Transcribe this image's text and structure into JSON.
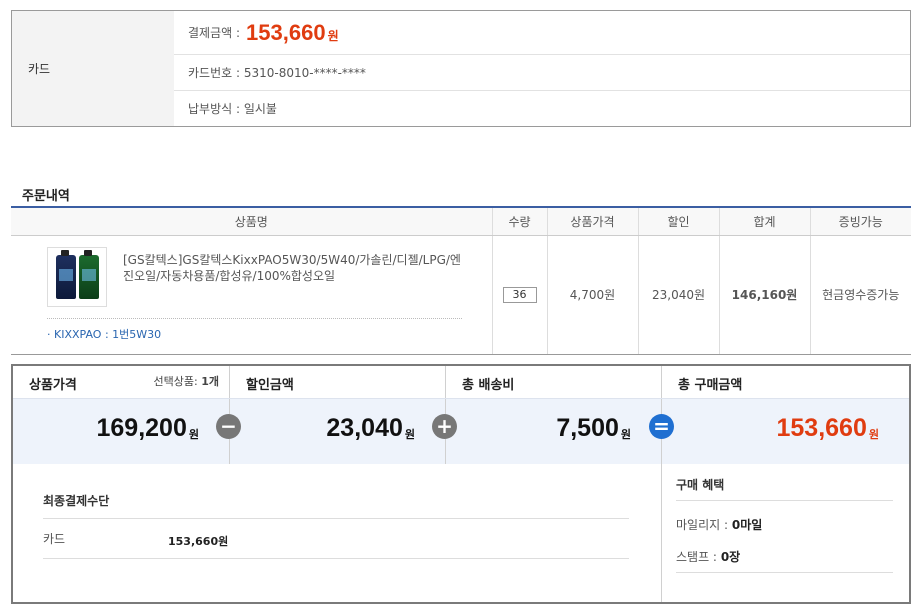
{
  "payment": {
    "method_label": "카드",
    "amount_label": "결제금액 :",
    "amount_value": "153,660",
    "amount_unit": "원",
    "card_number": "카드번호 : 5310-8010-****-****",
    "installment": "납부방식 : 일시불"
  },
  "order": {
    "section_title": "주문내역",
    "headers": [
      "상품명",
      "수량",
      "상품가격",
      "할인",
      "합계",
      "증빙가능"
    ],
    "item": {
      "name": "[GS칼텍스]GS칼텍스KixxPAO5W30/5W40/가솔린/디젤/LPG/엔진오일/자동차용품/합성유/100%합성오일",
      "option": "· KIXXPAO : 1번5W30",
      "quantity": "36",
      "price": "4,700원",
      "discount": "23,040원",
      "total": "146,160원",
      "proof": "현금영수증가능"
    }
  },
  "summary": {
    "product_price_label": "상품가격",
    "selected_label": "선택상품:",
    "selected_count": "1개",
    "discount_label": "할인금액",
    "shipping_label": "총 배송비",
    "total_label": "총 구매금액",
    "product_price": "169,200",
    "discount": "23,040",
    "shipping": "7,500",
    "total": "153,660",
    "unit": "원",
    "op_minus": "−",
    "op_plus": "+",
    "op_equal": "="
  },
  "final_payment": {
    "title": "최종결제수단",
    "method": "카드",
    "amount": "153,660원"
  },
  "benefits": {
    "title": "구매 혜택",
    "mileage_label": "마일리지 :",
    "mileage_value": "0마일",
    "stamp_label": "스탬프 :",
    "stamp_value": "0장"
  },
  "colors": {
    "accent_red": "#e03c10",
    "header_blue": "#3b5ea3",
    "equal_blue": "#1f6fd1"
  }
}
